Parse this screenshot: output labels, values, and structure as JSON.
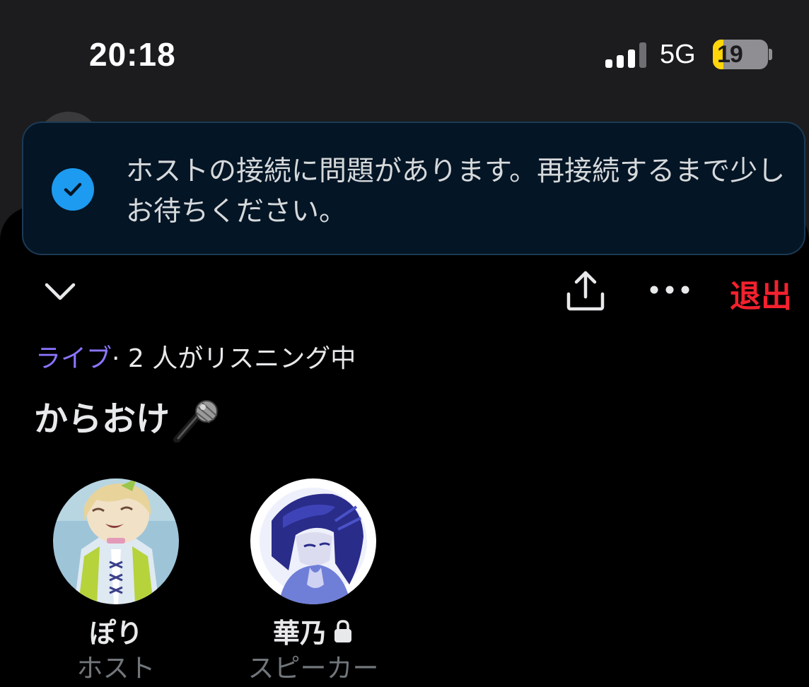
{
  "status_bar": {
    "time": "20:18",
    "network": "5G",
    "battery_level": "19",
    "battery_fraction": 0.19,
    "battery_color": "#ffd60a"
  },
  "toast": {
    "icon": "check-circle-icon",
    "icon_color": "#1d9bf0",
    "message": "ホストの接続に問題があります。再接続するまで少しお待ちください。"
  },
  "toolbar": {
    "collapse_icon": "chevron-down-icon",
    "share_icon": "share-icon",
    "more_icon": "more-icon",
    "leave_label": "退出",
    "leave_color": "#f4212e"
  },
  "space": {
    "live_label": "ライブ",
    "live_color": "#8a75ff",
    "listeners_text": "· 2 人がリスニング中",
    "title": "からおけ",
    "title_emoji_icon": "microphone-icon"
  },
  "participants": [
    {
      "name": "ぽり",
      "role": "ホスト"
    },
    {
      "name": "華乃",
      "role": "スピーカー",
      "locked_icon": "lock-icon"
    }
  ]
}
